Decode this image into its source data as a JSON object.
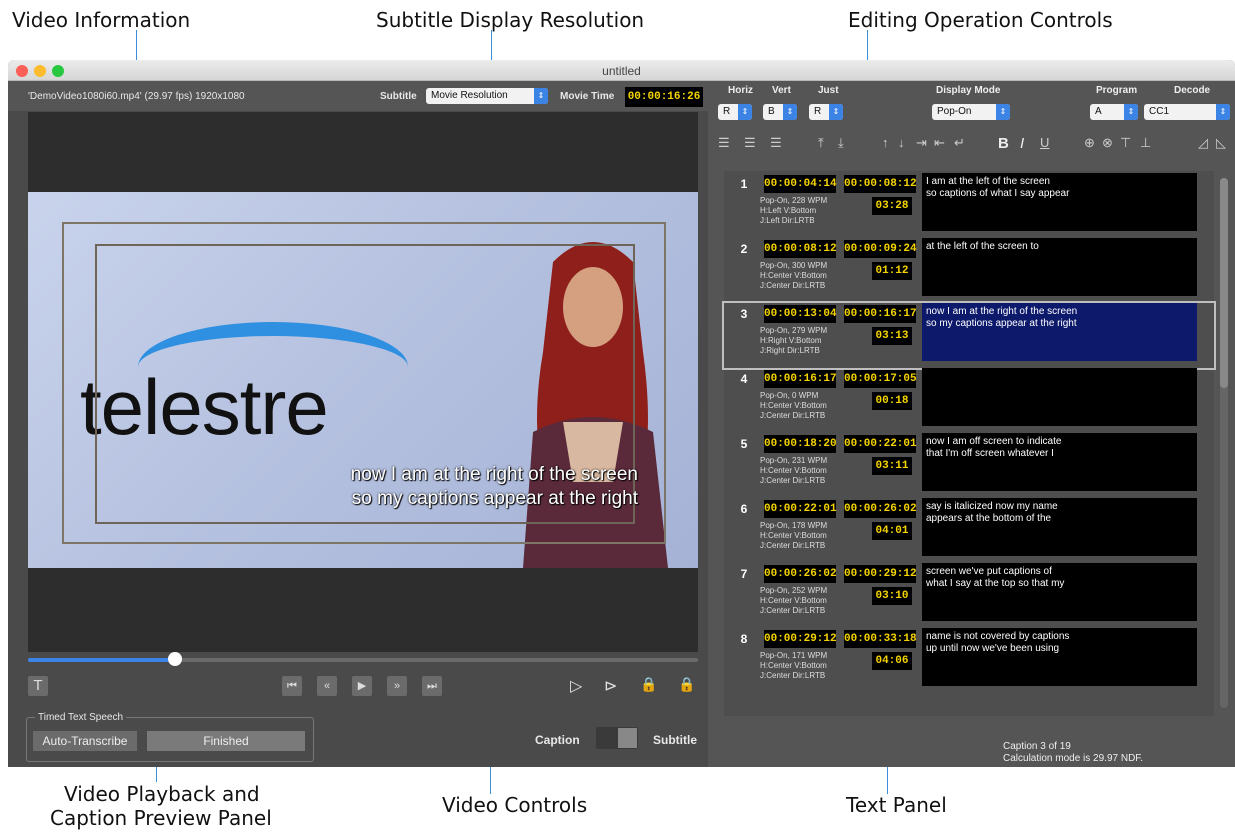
{
  "callouts": {
    "video_information": "Video Information",
    "subtitle_display_resolution": "Subtitle Display Resolution",
    "editing_operation_controls": "Editing Operation Controls",
    "video_playback_line1": "Video Playback and",
    "video_playback_line2": "Caption Preview Panel",
    "video_controls": "Video Controls",
    "text_panel": "Text Panel"
  },
  "window": {
    "title": "untitled"
  },
  "info_bar": {
    "file_info": "'DemoVideo1080i60.mp4'  (29.97 fps)  1920x1080",
    "subtitle_label": "Subtitle",
    "subtitle_value": "Movie Resolution",
    "movie_time_label": "Movie Time",
    "movie_time_value": "00:00:16:26"
  },
  "video": {
    "brand_text": "telestre",
    "caption_line1": "now I am at the right of the screen",
    "caption_line2": "so my captions appear at the right",
    "playhead_fraction": 0.22
  },
  "transport": {
    "t_button": "T",
    "rewind_end": "⏮",
    "rewind": "«",
    "play": "▶",
    "forward": "»",
    "forward_end": "⏭"
  },
  "speech": {
    "group_label": "Timed Text Speech",
    "auto_transcribe": "Auto-Transcribe",
    "status": "Finished"
  },
  "mode_toggle": {
    "caption": "Caption",
    "subtitle": "Subtitle"
  },
  "right_header": {
    "horiz_label": "Horiz",
    "horiz_value": "R",
    "vert_label": "Vert",
    "vert_value": "B",
    "just_label": "Just",
    "just_value": "R",
    "display_mode_label": "Display Mode",
    "display_mode_value": "Pop-On",
    "program_label": "Program",
    "program_value": "A",
    "decode_label": "Decode",
    "decode_value": "CC1"
  },
  "captions": [
    {
      "num": "1",
      "start": "00:00:04:14",
      "end": "00:00:08:12",
      "dur": "03:28",
      "meta1": "Pop-On, 228 WPM",
      "meta2": "H:Left V:Bottom",
      "meta3": "J:Left Dir:LRTB",
      "text1": "I am at the left of the screen",
      "text2": "so captions of what I say appear"
    },
    {
      "num": "2",
      "start": "00:00:08:12",
      "end": "00:00:09:24",
      "dur": "01:12",
      "meta1": "Pop-On, 300 WPM",
      "meta2": "H:Center V:Bottom",
      "meta3": "J:Center Dir:LRTB",
      "text1": "at the left of the screen to",
      "text2": ""
    },
    {
      "num": "3",
      "start": "00:00:13:04",
      "end": "00:00:16:17",
      "dur": "03:13",
      "meta1": "Pop-On, 279 WPM",
      "meta2": "H:Right V:Bottom",
      "meta3": "J:Right Dir:LRTB",
      "text1": "now I am at the right of the screen",
      "text2": "so my captions appear at the right"
    },
    {
      "num": "4",
      "start": "00:00:16:17",
      "end": "00:00:17:05",
      "dur": "00:18",
      "meta1": "Pop-On, 0 WPM",
      "meta2": "H:Center V:Bottom",
      "meta3": "J:Center Dir:LRTB",
      "text1": "",
      "text2": ""
    },
    {
      "num": "5",
      "start": "00:00:18:20",
      "end": "00:00:22:01",
      "dur": "03:11",
      "meta1": "Pop-On, 231 WPM",
      "meta2": "H:Center V:Bottom",
      "meta3": "J:Center Dir:LRTB",
      "text1": "now I am off screen to indicate",
      "text2": "that I'm off screen whatever I"
    },
    {
      "num": "6",
      "start": "00:00:22:01",
      "end": "00:00:26:02",
      "dur": "04:01",
      "meta1": "Pop-On, 178 WPM",
      "meta2": "H:Center V:Bottom",
      "meta3": "J:Center Dir:LRTB",
      "text1": "say is italicized now my name",
      "text2": "appears at the bottom of the"
    },
    {
      "num": "7",
      "start": "00:00:26:02",
      "end": "00:00:29:12",
      "dur": "03:10",
      "meta1": "Pop-On, 252 WPM",
      "meta2": "H:Center V:Bottom",
      "meta3": "J:Center Dir:LRTB",
      "text1": "screen we've put captions of",
      "text2": "what I say at the top so that my"
    },
    {
      "num": "8",
      "start": "00:00:29:12",
      "end": "00:00:33:18",
      "dur": "04:06",
      "meta1": "Pop-On, 171 WPM",
      "meta2": "H:Center V:Bottom",
      "meta3": "J:Center Dir:LRTB",
      "text1": "name is not covered by captions",
      "text2": "up until now we've been using"
    }
  ],
  "status": {
    "line1": "Caption 3 of 19",
    "line2": "Calculation mode is 29.97 NDF."
  },
  "colors": {
    "accent": "#3b84e5",
    "timecode": "#f5d400",
    "selected_caption_bg": "#0d1a6b",
    "callout_line": "#3a8fd8"
  }
}
